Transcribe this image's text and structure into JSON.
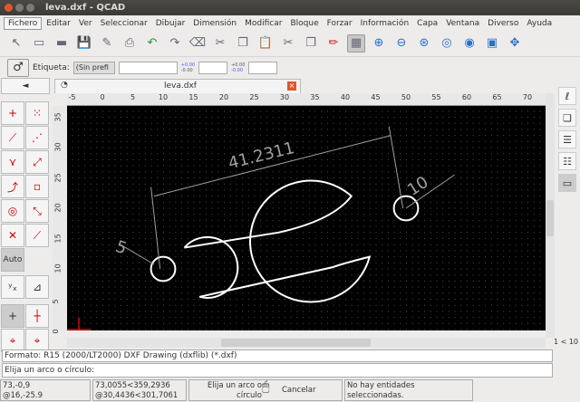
{
  "window": {
    "title": "leva.dxf - QCAD"
  },
  "menu": [
    "Fichero",
    "Editar",
    "Ver",
    "Seleccionar",
    "Dibujar",
    "Dimensión",
    "Modificar",
    "Bloque",
    "Forzar",
    "Información",
    "Capa",
    "Ventana",
    "Diverso",
    "Ayuda"
  ],
  "toolbar": {
    "icons": [
      "pointer-icon",
      "new-file-icon",
      "open-folder-icon",
      "save-icon",
      "save-as-icon",
      "print-icon",
      "undo-icon",
      "redo-icon",
      "eraser-icon",
      "cut-icon",
      "copy-icon",
      "paste-icon",
      "cut-ref-icon",
      "copy-ref-icon",
      "pen-icon",
      "grid-icon",
      "zoom-in-icon",
      "zoom-out-icon",
      "zoom-auto-icon",
      "zoom-previous-icon",
      "zoom-redraw-icon",
      "zoom-window-icon",
      "zoom-pan-icon"
    ],
    "glyphs": [
      "↖",
      "▭",
      "▬",
      "💾",
      "✎",
      "⎙",
      "↶",
      "↷",
      "⌫",
      "✂",
      "❐",
      "📋",
      "✂",
      "❐",
      "✏",
      "▦",
      "⊕",
      "⊖",
      "⊛",
      "◎",
      "◉",
      "▣",
      "✥"
    ]
  },
  "options": {
    "label": "Etiqueta:",
    "prefix": "(Sin prefi",
    "plus": "+0.00",
    "minus": "-0.00"
  },
  "leftbar": {
    "back": "◄",
    "auto": "Auto"
  },
  "tab": {
    "name": "leva.dxf"
  },
  "ruler": {
    "x_ticks": [
      "-5",
      "0",
      "5",
      "10",
      "15",
      "20",
      "25",
      "30",
      "35",
      "40",
      "45",
      "50",
      "55",
      "60",
      "65",
      "70"
    ],
    "y_ticks": [
      "35",
      "30",
      "25",
      "20",
      "15",
      "10",
      "5",
      "0"
    ]
  },
  "drawing": {
    "dim_length": "41.2311",
    "dim_r_small": "5",
    "dim_r_large": "10",
    "color_bg": "#000000",
    "color_line": "#ffffff",
    "color_dim": "#a0a0a0"
  },
  "scroll": {
    "page": "1 < 10"
  },
  "format": "Formato: R15 (2000/LT2000) DXF Drawing (dxflib) (*.dxf)",
  "command": "Elija un arco o círculo:",
  "status": {
    "abs": "73,-0,9",
    "rel": "@16,-25.9",
    "polar": "73,0055<359,2936",
    "polar_rel": "@30,4436<301,7061",
    "prompt1": "Elija un arco o",
    "prompt2": "círculo",
    "cancel": "Cancelar",
    "selection1": "No hay entidades",
    "selection2": "seleccionadas."
  }
}
